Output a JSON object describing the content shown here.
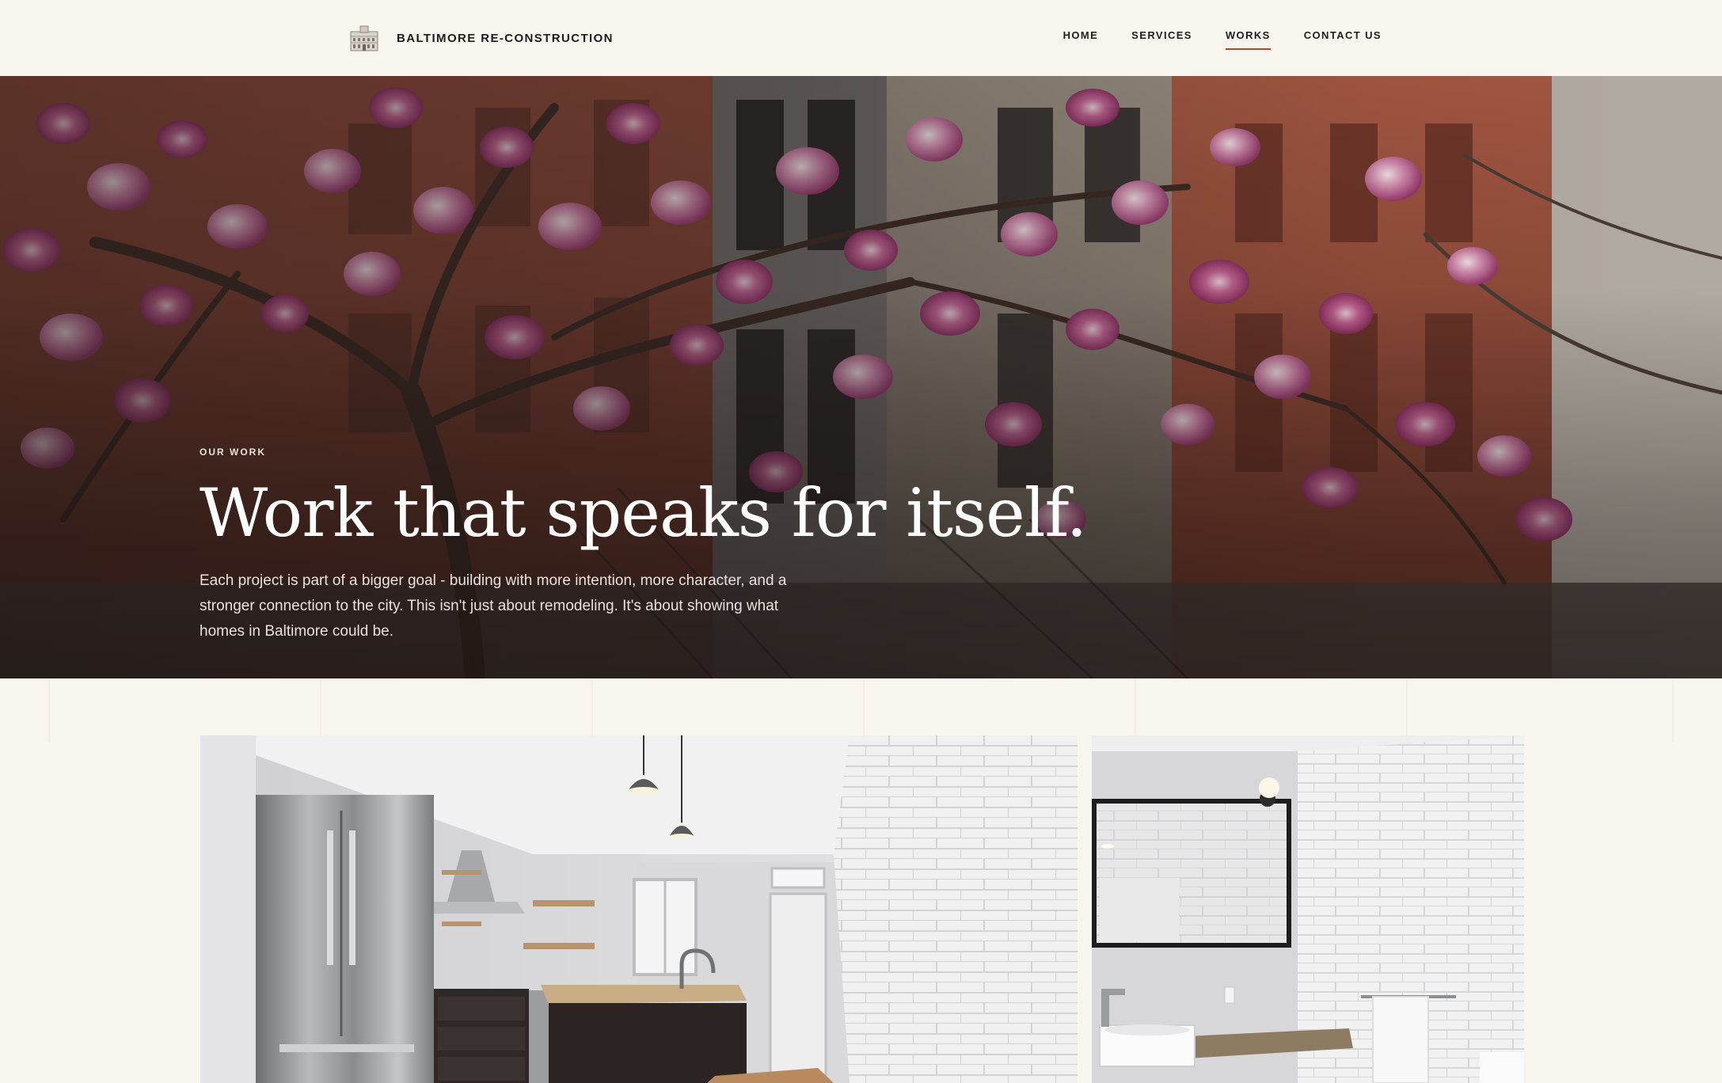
{
  "header": {
    "brand": "BALTIMORE RE-CONSTRUCTION",
    "brand_icon": "building-logo-icon",
    "nav": [
      {
        "label": "HOME",
        "active": false
      },
      {
        "label": "SERVICES",
        "active": false
      },
      {
        "label": "WORKS",
        "active": true
      },
      {
        "label": "CONTACT US",
        "active": false
      }
    ]
  },
  "hero": {
    "eyebrow": "OUR WORK",
    "title": "Work that speaks for itself.",
    "description": "Each project is part of a bigger goal - building with more intention, more character, and a stronger connection to the city. This isn't just about remodeling. It's about showing what homes in Baltimore could be.",
    "image": "magnolia-tree-rowhouses-photo"
  },
  "gallery": [
    {
      "image": "renovated-kitchen-photo"
    },
    {
      "image": "renovated-bathroom-photo"
    }
  ],
  "colors": {
    "background": "#f8f5ef",
    "accent": "#b1493b",
    "text": "#1d1d1d"
  }
}
